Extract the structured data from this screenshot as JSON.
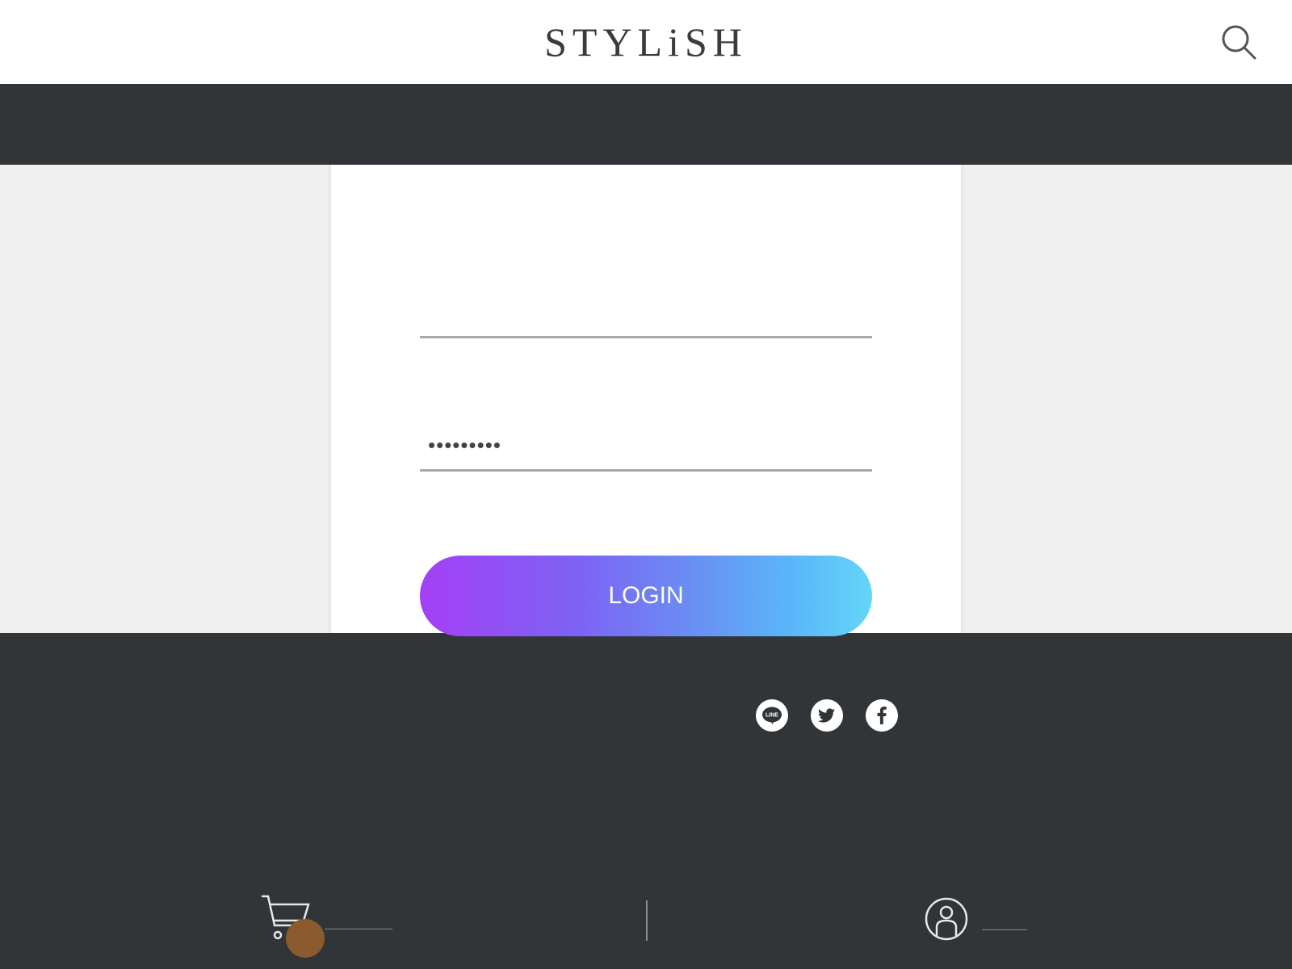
{
  "header": {
    "logo_text": "STYLiSH",
    "search_icon": "search-icon"
  },
  "login_form": {
    "email_value": "",
    "password_value": "•••••••••",
    "login_label": "LOGIN"
  },
  "footer": {
    "social_icons": [
      "line-icon",
      "twitter-icon",
      "facebook-icon"
    ]
  },
  "bottom_bar": {
    "cart_icon": "cart-icon",
    "member_icon": "member-icon",
    "badge_color": "#8b5a2e"
  },
  "colors": {
    "dark": "#313538",
    "gradient_start": "#a43ff5",
    "gradient_end": "#63d6f8"
  }
}
